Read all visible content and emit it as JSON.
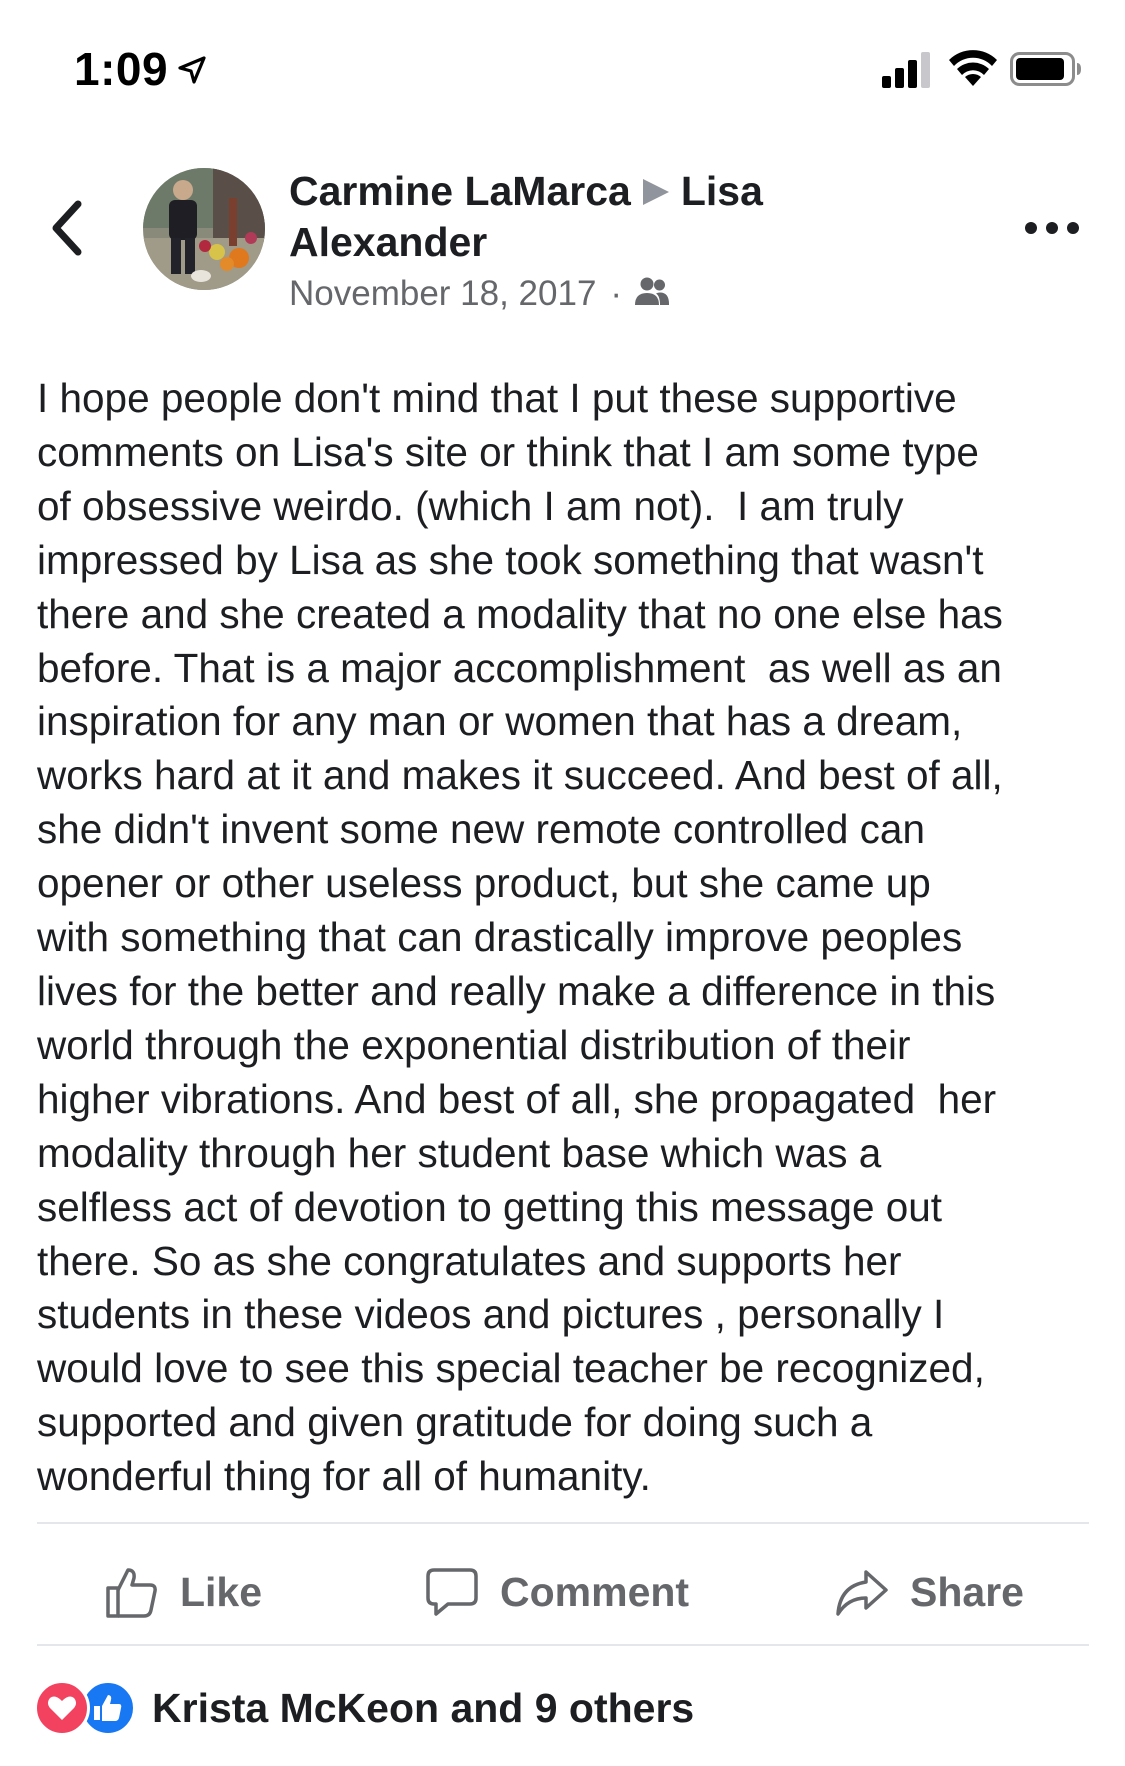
{
  "status_bar": {
    "time": "1:09"
  },
  "post": {
    "author": "Carmine LaMarca",
    "recipient": "Lisa Alexander",
    "date": "November 18, 2017",
    "separator": "·",
    "privacy_icon": "friends-icon",
    "body": "I hope people don't mind that I put these supportive\ncomments on Lisa's site or think that I am some type\nof obsessive weirdo. (which I am not).  I am truly\nimpressed by Lisa as she took something that wasn't\nthere and she created a modality that no one else has\nbefore. That is a major accomplishment  as well as an\ninspiration for any man or women that has a dream,\nworks hard at it and makes it succeed. And best of all,\nshe didn't invent some new remote controlled can\nopener or other useless product, but she came up\nwith something that can drastically improve peoples\nlives for the better and really make a difference in this\nworld through the exponential distribution of their\nhigher vibrations. And best of all, she propagated  her\nmodality through her student base which was a\nselfless act of devotion to getting this message out\nthere. So as she congratulates and supports her\nstudents in these videos and pictures , personally I\nwould love to see this special teacher be recognized,\nsupported and given gratitude for doing such a\nwonderful thing for all of humanity."
  },
  "actions": {
    "like_label": "Like",
    "comment_label": "Comment",
    "share_label": "Share"
  },
  "reactions": {
    "summary": "Krista McKeon and 9 others",
    "types": [
      "love",
      "like"
    ]
  },
  "colors": {
    "text_primary": "#1c1e21",
    "text_secondary": "#65676b",
    "divider": "#e4e6eb",
    "love_red": "#f3425f",
    "like_blue": "#1877f2"
  }
}
